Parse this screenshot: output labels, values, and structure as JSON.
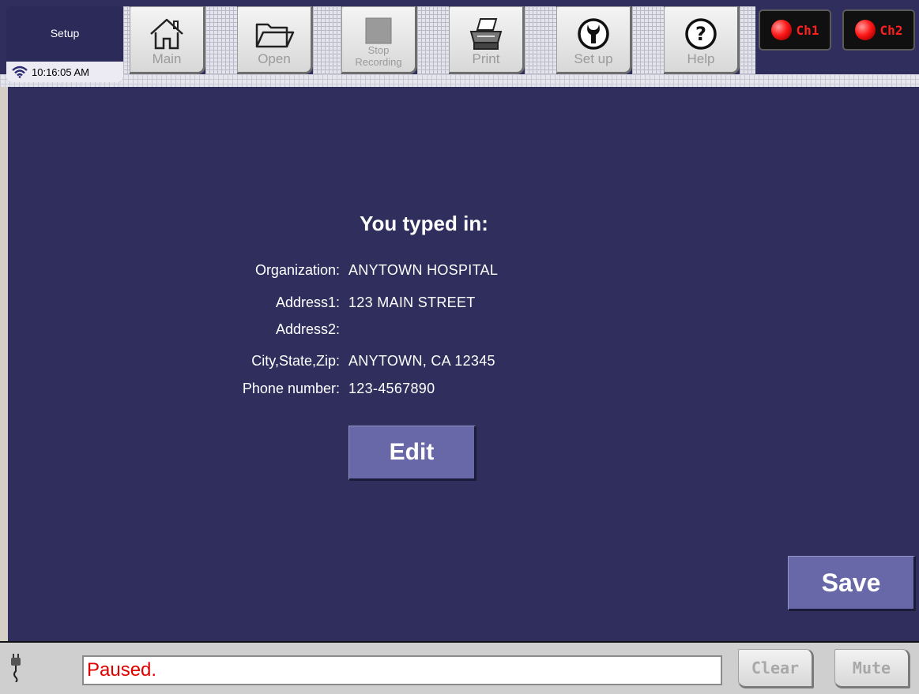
{
  "toolbar": {
    "mode": "Setup",
    "time": "10:16:05 AM",
    "buttons": {
      "main": "Main",
      "open": "Open",
      "stop_line1": "Stop",
      "stop_line2": "Recording",
      "print": "Print",
      "setup": "Set up",
      "help": "Help"
    },
    "channels": [
      "Ch1",
      "Ch2"
    ]
  },
  "main": {
    "heading": "You typed in:",
    "fields": [
      {
        "label": "Organization:",
        "value": "ANYTOWN HOSPITAL"
      },
      {
        "label": "Address1:",
        "value": "123 MAIN STREET"
      },
      {
        "label": "Address2:",
        "value": ""
      },
      {
        "label": "City,State,Zip:",
        "value": "ANYTOWN, CA 12345"
      },
      {
        "label": "Phone number:",
        "value": "123-4567890"
      }
    ],
    "edit_label": "Edit",
    "save_label": "Save"
  },
  "statusbar": {
    "status_text": "Paused.",
    "clear_label": "Clear",
    "mute_label": "Mute"
  },
  "colors": {
    "panel_bg": "#2f2e5c",
    "button_purple": "#6868a8",
    "status_red": "#e00000",
    "led_red": "#ff1a1a"
  },
  "icons": [
    "wifi-icon",
    "home-icon",
    "folder-icon",
    "stop-icon",
    "printer-icon",
    "wrench-icon",
    "help-icon",
    "plug-icon"
  ]
}
